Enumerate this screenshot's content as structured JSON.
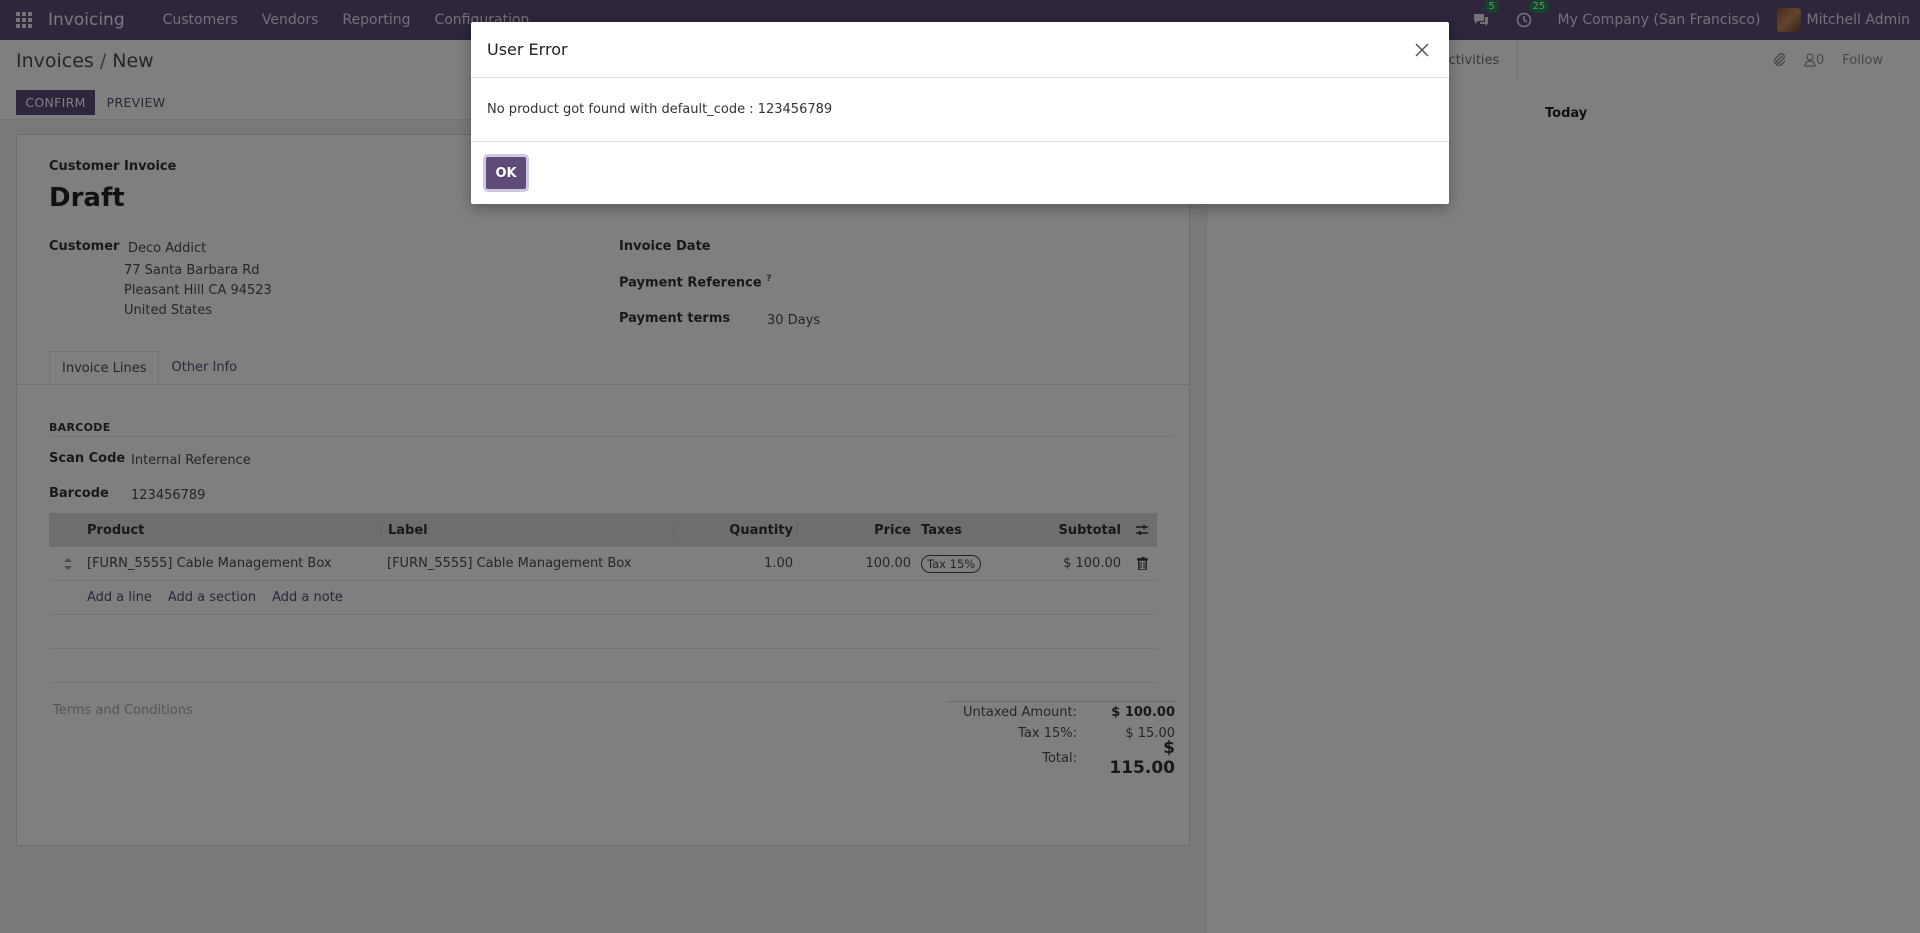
{
  "navbar": {
    "app_name": "Invoicing",
    "menu": [
      "Customers",
      "Vendors",
      "Reporting",
      "Configuration"
    ],
    "messages_count": "5",
    "activities_count": "25",
    "company": "My Company (San Francisco)",
    "user": "Mitchell Admin"
  },
  "control_panel": {
    "breadcrumb_parent": "Invoices",
    "breadcrumb_sep": "/",
    "breadcrumb_current": "New",
    "confirm_label": "CONFIRM",
    "preview_label": "PREVIEW",
    "activities_label": "Activities",
    "followers_count": "0",
    "follow_label": "Follow"
  },
  "form": {
    "doc_type": "Customer Invoice",
    "status_name": "Draft",
    "customer_label": "Customer",
    "customer_name": "Deco Addict",
    "address_line1": "77 Santa Barbara Rd",
    "address_line2": "Pleasant Hill CA 94523",
    "address_line3": "United States",
    "invoice_date_label": "Invoice Date",
    "payment_ref_label": "Payment Reference",
    "payment_ref_help": "?",
    "payment_terms_label": "Payment terms",
    "payment_terms_value": "30 Days",
    "tabs": [
      "Invoice Lines",
      "Other Info"
    ],
    "barcode_section": "BARCODE",
    "scan_code_label": "Scan Code",
    "scan_code_value": "Internal Reference",
    "barcode_label": "Barcode",
    "barcode_value": "123456789"
  },
  "table": {
    "headers": {
      "product": "Product",
      "label": "Label",
      "quantity": "Quantity",
      "price": "Price",
      "taxes": "Taxes",
      "subtotal": "Subtotal"
    },
    "rows": [
      {
        "product": "[FURN_5555] Cable Management Box",
        "label": "[FURN_5555] Cable Management Box",
        "quantity": "1.00",
        "price": "100.00",
        "taxes": "Tax 15%",
        "subtotal": "$ 100.00"
      }
    ],
    "add_line": "Add a line",
    "add_section": "Add a section",
    "add_note": "Add a note"
  },
  "totals": {
    "terms_placeholder": "Terms and Conditions",
    "untaxed_label": "Untaxed Amount:",
    "untaxed_value": "$ 100.00",
    "tax_label": "Tax 15%:",
    "tax_value": "$ 15.00",
    "total_label": "Total:",
    "total_value": "$ 115.00"
  },
  "chatter": {
    "today_label": "Today"
  },
  "dialog": {
    "title": "User Error",
    "message": "No product got found with default_code : 123456789",
    "ok_label": "OK"
  },
  "colors": {
    "brand": "#5e4b78",
    "badge": "#1e8f4f"
  }
}
